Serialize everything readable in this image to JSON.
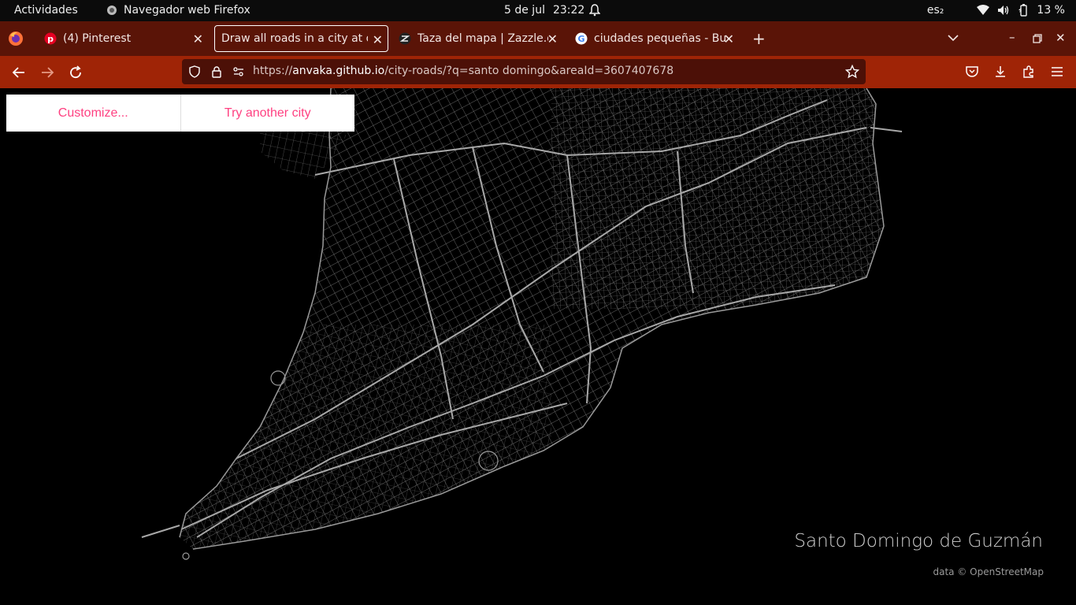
{
  "system_bar": {
    "activities": "Actividades",
    "app_name": "Navegador web Firefox",
    "date": "5 de jul",
    "time": "23:22",
    "language": "es₂",
    "battery": "13 %"
  },
  "tabs": [
    {
      "label": "(4) Pinterest",
      "icon": "pinterest-icon",
      "active": false
    },
    {
      "label": "Draw all roads in a city at once",
      "icon": "",
      "active": true
    },
    {
      "label": "Taza del mapa | Zazzle.com",
      "icon": "zazzle-icon",
      "active": false
    },
    {
      "label": "ciudades pequeñas - Buscar con Google",
      "icon": "google-icon",
      "active": false
    }
  ],
  "url": {
    "scheme": "https://",
    "host": "anvaka.github.io",
    "path": "/city-roads/?q=santo domingo&areaId=3607407678"
  },
  "page": {
    "customize_label": "Customize...",
    "try_another_label": "Try another city",
    "city_name": "Santo Domingo de Guzmán",
    "attribution": "data © OpenStreetMap"
  },
  "colors": {
    "tab_strip": "#5a1407",
    "nav_bar": "#9f2406",
    "url_bar": "#4c1007",
    "accent_pink": "#ff4081",
    "road_stroke": "#8a8a8a",
    "background": "#000000"
  }
}
